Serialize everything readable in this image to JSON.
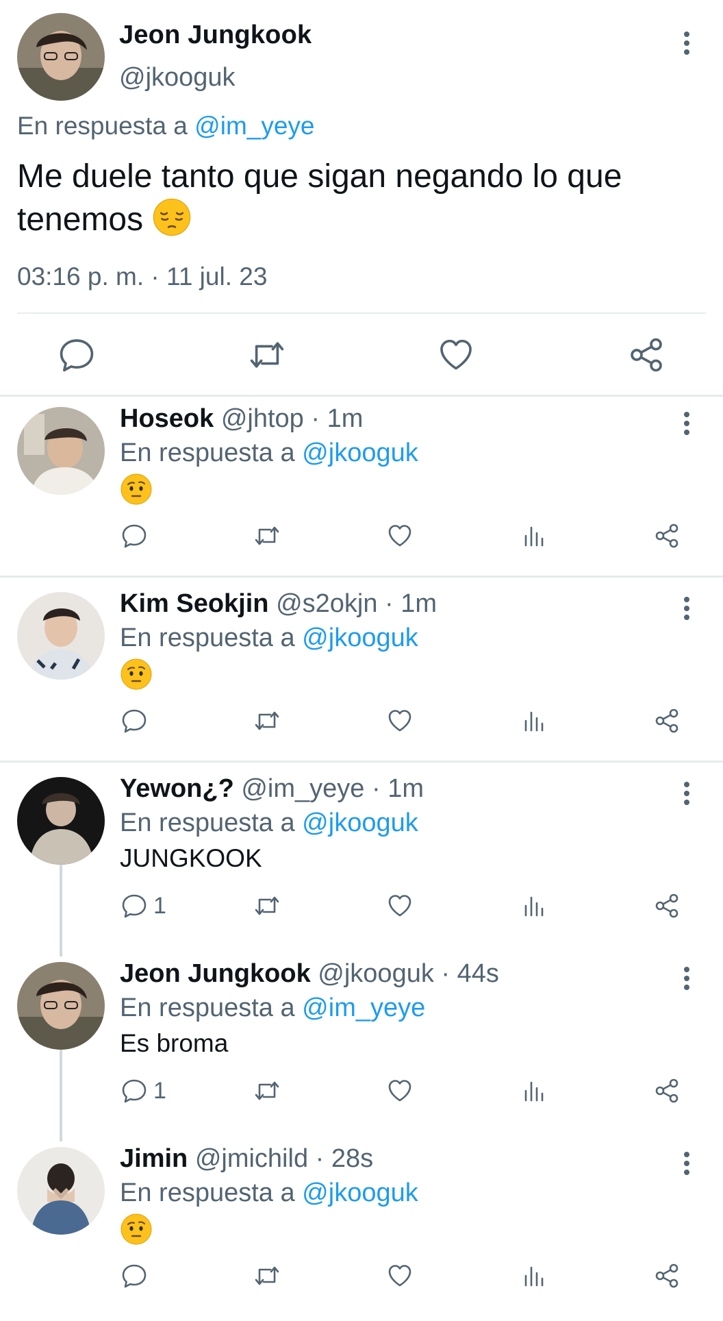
{
  "main_tweet": {
    "name": "Jeon Jungkook",
    "handle": "@jkooguk",
    "reply_prefix": "En respuesta a",
    "reply_to": "@im_yeye",
    "text": "Me duele tanto que sigan negando lo que tenemos",
    "emoji": "pensive-face",
    "timestamp": "03:16 p. m. · 11 jul. 23"
  },
  "replies": [
    {
      "name": "Hoseok",
      "handle": "@jhtop · 1m",
      "reply_prefix": "En respuesta a",
      "reply_to": "@jkooguk",
      "emoji": "face-with-raised-eyebrow",
      "text": "",
      "reply_count": ""
    },
    {
      "name": "Kim Seokjin",
      "handle": "@s2okjn · 1m",
      "reply_prefix": "En respuesta a",
      "reply_to": "@jkooguk",
      "emoji": "face-with-raised-eyebrow",
      "text": "",
      "reply_count": ""
    },
    {
      "name": "Yewon¿?",
      "handle": "@im_yeye · 1m",
      "reply_prefix": "En respuesta a",
      "reply_to": "@jkooguk",
      "emoji": "",
      "text": "JUNGKOOK",
      "reply_count": "1"
    },
    {
      "name": "Jeon Jungkook",
      "handle": "@jkooguk · 44s",
      "reply_prefix": "En respuesta a",
      "reply_to": "@im_yeye",
      "emoji": "",
      "text": "Es broma",
      "reply_count": "1"
    },
    {
      "name": "Jimin",
      "handle": "@jmichild · 28s",
      "reply_prefix": "En respuesta a",
      "reply_to": "@jkooguk",
      "emoji": "face-with-raised-eyebrow",
      "text": "",
      "reply_count": ""
    }
  ],
  "icons": {
    "reply": "reply-icon",
    "retweet": "retweet-icon",
    "like": "heart-icon",
    "views": "analytics-icon",
    "share": "share-icon",
    "more": "more-vertical-icon"
  },
  "colors": {
    "link": "#1d9bf0",
    "secondary_text": "#536471",
    "primary_text": "#0f1419",
    "divider": "#e6eaec"
  }
}
